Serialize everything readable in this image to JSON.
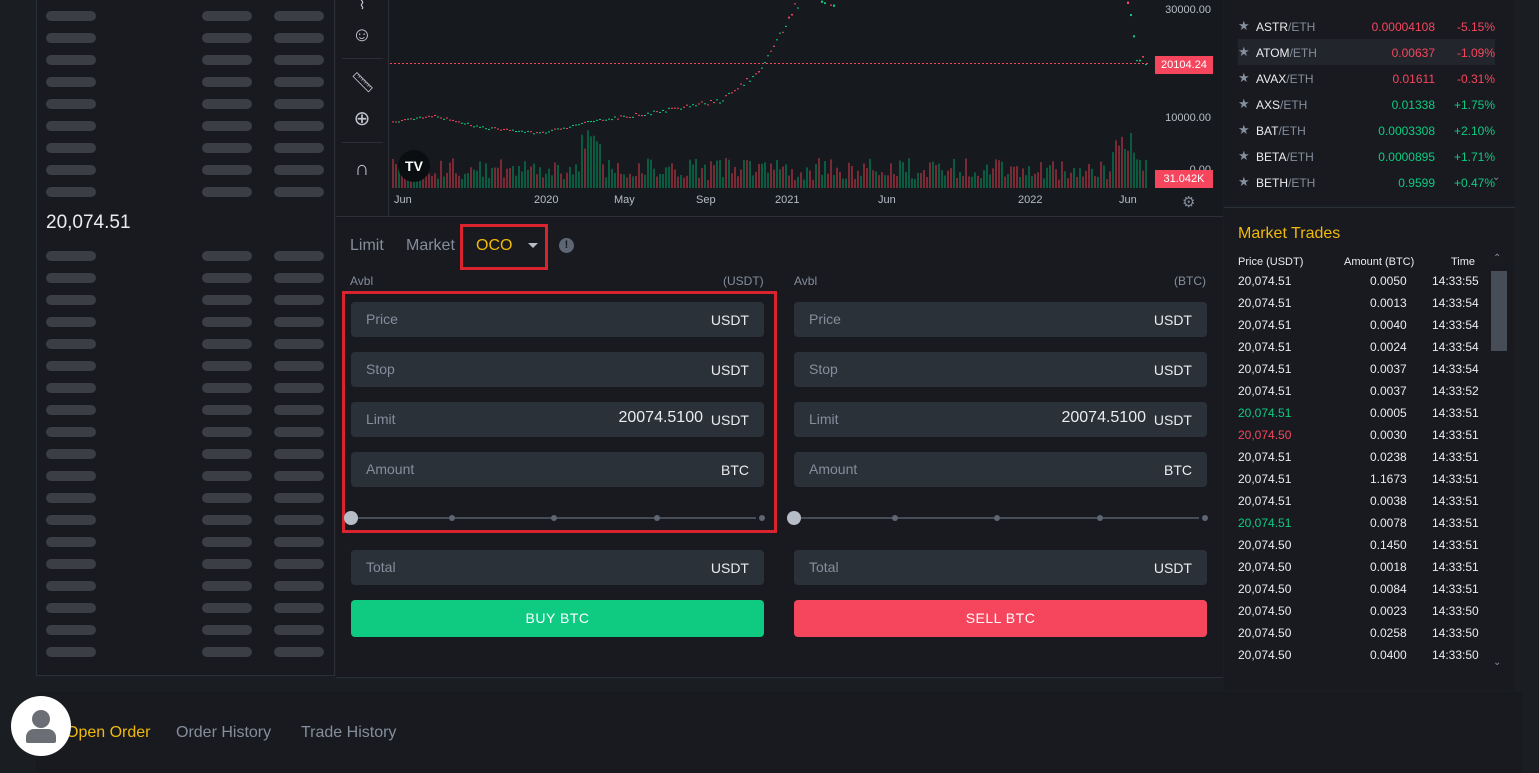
{
  "orderbook": {
    "mid_price": "20,074.51"
  },
  "chart": {
    "y_ticks": [
      "30000.00",
      "10000.00",
      "0.00"
    ],
    "last_price_tag": "20104.24",
    "volume_tag": "31.042K",
    "x_ticks": [
      "Jun",
      "2020",
      "May",
      "Sep",
      "2021",
      "Jun",
      "2022",
      "Jun"
    ],
    "logo": "TV"
  },
  "trade": {
    "tabs": {
      "limit": "Limit",
      "market": "Market",
      "oco": "OCO"
    },
    "info": "!",
    "buy": {
      "avbl_label": "Avbl",
      "avbl_unit": "(USDT)",
      "price_label": "Price",
      "price_unit": "USDT",
      "stop_label": "Stop",
      "stop_unit": "USDT",
      "limit_label": "Limit",
      "limit_value": "20074.5100",
      "limit_unit": "USDT",
      "amount_label": "Amount",
      "amount_unit": "BTC",
      "total_label": "Total",
      "total_unit": "USDT",
      "button": "BUY BTC"
    },
    "sell": {
      "avbl_label": "Avbl",
      "avbl_unit": "(BTC)",
      "price_label": "Price",
      "price_unit": "USDT",
      "stop_label": "Stop",
      "stop_unit": "USDT",
      "limit_label": "Limit",
      "limit_value": "20074.5100",
      "limit_unit": "USDT",
      "amount_label": "Amount",
      "amount_unit": "BTC",
      "total_label": "Total",
      "total_unit": "USDT",
      "button": "SELL BTC"
    }
  },
  "pairs": [
    {
      "base": "ASTR",
      "quote": "/ETH",
      "price": "0.00004108",
      "change": "-5.15%",
      "up": false
    },
    {
      "base": "ATOM",
      "quote": "/ETH",
      "price": "0.00637",
      "change": "-1.09%",
      "up": false
    },
    {
      "base": "AVAX",
      "quote": "/ETH",
      "price": "0.01611",
      "change": "-0.31%",
      "up": false
    },
    {
      "base": "AXS",
      "quote": "/ETH",
      "price": "0.01338",
      "change": "+1.75%",
      "up": true
    },
    {
      "base": "BAT",
      "quote": "/ETH",
      "price": "0.0003308",
      "change": "+2.10%",
      "up": true
    },
    {
      "base": "BETA",
      "quote": "/ETH",
      "price": "0.0000895",
      "change": "+1.71%",
      "up": true
    },
    {
      "base": "BETH",
      "quote": "/ETH",
      "price": "0.9599",
      "change": "+0.47%",
      "up": true
    }
  ],
  "market_trades": {
    "title": "Market Trades",
    "headers": {
      "price": "Price (USDT)",
      "amount": "Amount (BTC)",
      "time": "Time"
    },
    "rows": [
      {
        "price": "20,074.51",
        "amount": "0.0050",
        "time": "14:33:55",
        "color": "neutral"
      },
      {
        "price": "20,074.51",
        "amount": "0.0013",
        "time": "14:33:54",
        "color": "neutral"
      },
      {
        "price": "20,074.51",
        "amount": "0.0040",
        "time": "14:33:54",
        "color": "neutral"
      },
      {
        "price": "20,074.51",
        "amount": "0.0024",
        "time": "14:33:54",
        "color": "neutral"
      },
      {
        "price": "20,074.51",
        "amount": "0.0037",
        "time": "14:33:54",
        "color": "neutral"
      },
      {
        "price": "20,074.51",
        "amount": "0.0037",
        "time": "14:33:52",
        "color": "neutral"
      },
      {
        "price": "20,074.51",
        "amount": "0.0005",
        "time": "14:33:51",
        "color": "green"
      },
      {
        "price": "20,074.50",
        "amount": "0.0030",
        "time": "14:33:51",
        "color": "red"
      },
      {
        "price": "20,074.51",
        "amount": "0.0238",
        "time": "14:33:51",
        "color": "neutral"
      },
      {
        "price": "20,074.51",
        "amount": "1.1673",
        "time": "14:33:51",
        "color": "neutral"
      },
      {
        "price": "20,074.51",
        "amount": "0.0038",
        "time": "14:33:51",
        "color": "neutral"
      },
      {
        "price": "20,074.51",
        "amount": "0.0078",
        "time": "14:33:51",
        "color": "green"
      },
      {
        "price": "20,074.50",
        "amount": "0.1450",
        "time": "14:33:51",
        "color": "neutral"
      },
      {
        "price": "20,074.50",
        "amount": "0.0018",
        "time": "14:33:51",
        "color": "neutral"
      },
      {
        "price": "20,074.50",
        "amount": "0.0084",
        "time": "14:33:51",
        "color": "neutral"
      },
      {
        "price": "20,074.50",
        "amount": "0.0023",
        "time": "14:33:50",
        "color": "neutral"
      },
      {
        "price": "20,074.50",
        "amount": "0.0258",
        "time": "14:33:50",
        "color": "neutral"
      },
      {
        "price": "20,074.50",
        "amount": "0.0400",
        "time": "14:33:50",
        "color": "neutral"
      }
    ]
  },
  "bottom_tabs": [
    "Open Order",
    "Order History",
    "Trade History"
  ],
  "colors": {
    "accent": "#f0b90b",
    "buy": "#0ecb81",
    "sell": "#f6465d",
    "highlight": "#d9232e"
  }
}
